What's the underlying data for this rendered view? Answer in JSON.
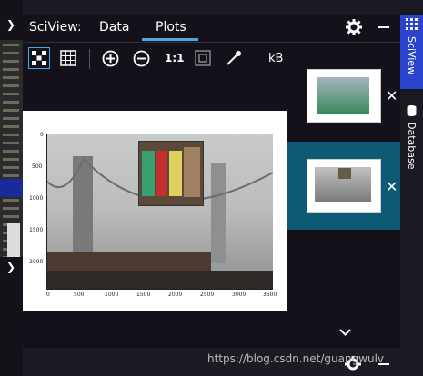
{
  "left_panel": {
    "chevron_top": "❯",
    "chevron_bottom": "❯"
  },
  "tabs": {
    "app_label": "SciView:",
    "items": [
      {
        "label": "Data"
      },
      {
        "label": "Plots"
      }
    ],
    "active": "Plots"
  },
  "toolbar": {
    "icons": [
      "grid-icon",
      "table-grid-icon",
      "zoom-in-icon",
      "zoom-out-icon",
      "actual-size-icon",
      "fit-icon",
      "color-picker-icon"
    ],
    "actual_size_label": "1:1",
    "size_label": "kB"
  },
  "plot": {
    "x_ticks": [
      "0",
      "500",
      "1000",
      "1500",
      "2000",
      "2500",
      "3000",
      "3500"
    ],
    "y_ticks": [
      "0",
      "500",
      "1000",
      "1500",
      "2000"
    ]
  },
  "thumbnails": [
    {
      "selected": false
    },
    {
      "selected": true
    }
  ],
  "sidebar": {
    "tabs": [
      {
        "label": "SciView"
      },
      {
        "label": "Database"
      }
    ]
  },
  "watermark": "https://blog.csdn.net/guangwulv",
  "colors": {
    "accent": "#4aa8e8",
    "selected_thumb_bg": "#0e5a74",
    "sidebar_active": "#2a44d0"
  }
}
